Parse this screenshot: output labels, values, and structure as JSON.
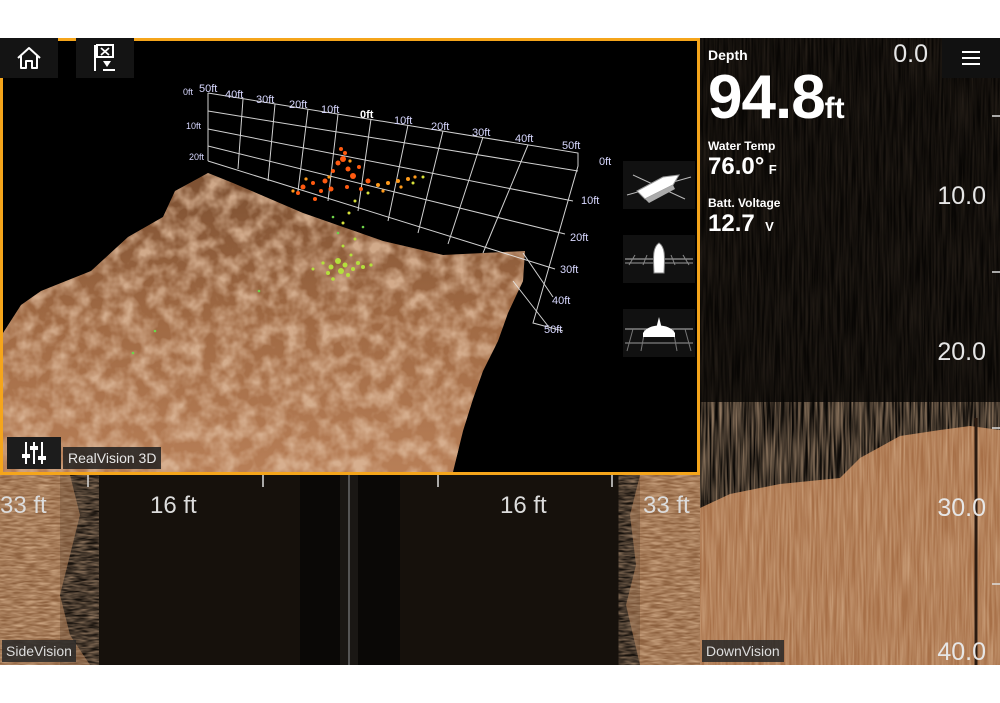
{
  "realvision": {
    "label": "RealVision 3D",
    "top_scale": [
      "50ft",
      "40ft",
      "30ft",
      "20ft",
      "10ft",
      "0ft",
      "10ft",
      "20ft",
      "30ft",
      "40ft",
      "50ft"
    ],
    "left_depth": [
      "0ft",
      "10ft",
      "20ft"
    ],
    "right_depth": [
      "0ft",
      "10ft",
      "20ft",
      "30ft",
      "40ft",
      "50ft"
    ],
    "views": [
      "side-perspective-view",
      "top-rear-view",
      "front-view"
    ]
  },
  "sidevision": {
    "label": "SideVision",
    "ranges": [
      "33 ft",
      "16 ft",
      "16 ft",
      "33 ft"
    ]
  },
  "downvision": {
    "label": "DownVision",
    "top_value": "0.0",
    "scale": [
      "10.0",
      "20.0",
      "30.0",
      "40.0"
    ],
    "depth": {
      "label": "Depth",
      "value": "94.8",
      "unit": "ft"
    },
    "water_temp": {
      "label": "Water Temp",
      "value": "76.0°",
      "unit": "F"
    },
    "voltage": {
      "label": "Batt. Voltage",
      "value": "12.7",
      "unit": "V"
    }
  },
  "icons": {
    "home": "home-icon",
    "clear": "clear-history-icon",
    "menu": "menu-icon",
    "settings": "sliders-icon"
  },
  "colors": {
    "accent": "#f5a51b",
    "sonar": "#b77a4c",
    "background": "#000000"
  }
}
